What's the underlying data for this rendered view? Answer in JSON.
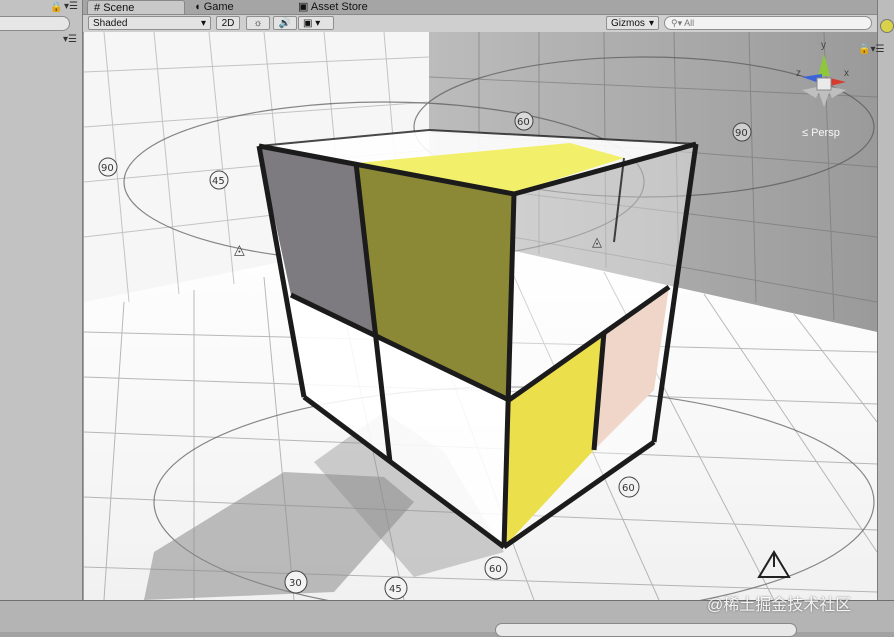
{
  "tabs": {
    "scene": "Scene",
    "game": "Game",
    "asset_store": "Asset Store"
  },
  "toolbar": {
    "shading_mode": "Shaded",
    "mode_2d": "2D",
    "gizmos": "Gizmos",
    "search_placeholder": "All"
  },
  "gizmo": {
    "projection": "Persp",
    "x": "x",
    "y": "y",
    "z": "z"
  },
  "angle_labels": [
    "30",
    "45",
    "60",
    "60",
    "90",
    "45",
    "60",
    "90"
  ],
  "watermark": "@稀土掘金技术社区",
  "colors": {
    "cube_yellow_top": "#f2ef6a",
    "cube_olive": "#8b8935",
    "cube_gray": "#7d7a80",
    "cube_yellow_front": "#ecdf4c",
    "cube_peach": "#efd6c9",
    "cube_edge": "#1b1b1b"
  },
  "icons": {
    "scene_tab": "grid-hash-icon",
    "game_tab": "pacman-icon",
    "asset_tab": "store-icon",
    "light": "sun-icon",
    "audio": "speaker-icon",
    "fx": "image-icon",
    "lock": "lock-icon",
    "menu": "tab-menu-icon"
  }
}
